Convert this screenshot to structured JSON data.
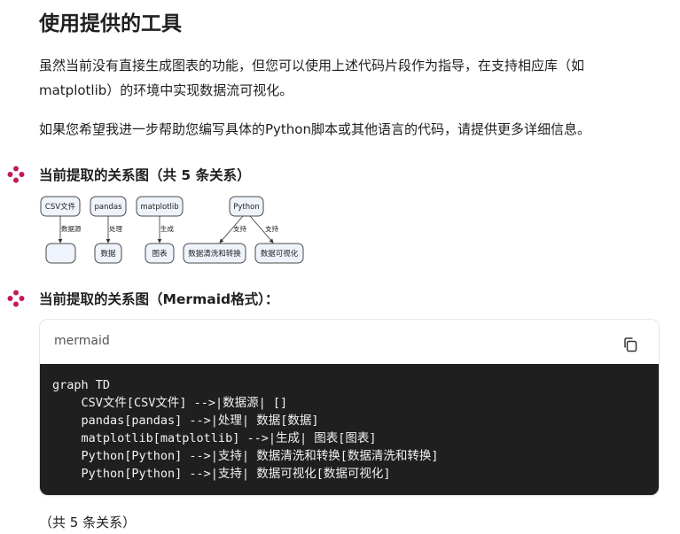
{
  "heading": "使用提供的工具",
  "paragraph1": "虽然当前没有直接生成图表的功能，但您可以使用上述代码片段作为指导，在支持相应库（如matplotlib）的环境中实现数据流可视化。",
  "paragraph2": "如果您希望我进一步帮助您编写具体的Python脚本或其他语言的代码，请提供更多详细信息。",
  "section1_title": "当前提取的关系图（共 5 条关系）",
  "section2_title": "当前提取的关系图（Mermaid格式）：",
  "diagram": {
    "nodes": {
      "csv": "CSV文件",
      "pandas": "pandas",
      "matplotlib": "matplotlib",
      "python": "Python",
      "empty": "",
      "data": "数据",
      "chart": "图表",
      "clean": "数据清洗和转换",
      "viz": "数据可视化"
    },
    "edges": {
      "csv_empty": "数据源",
      "pandas_data": "处理",
      "matplotlib_chart": "生成",
      "python_clean": "支持",
      "python_viz": "支持"
    }
  },
  "code_block": {
    "language": "mermaid",
    "copy_icon": "copy-icon",
    "lines": [
      "graph TD",
      "    CSV文件[CSV文件] -->|数据源| []",
      "    pandas[pandas] -->|处理| 数据[数据]",
      "    matplotlib[matplotlib] -->|生成| 图表[图表]",
      "    Python[Python] -->|支持| 数据清洗和转换[数据清洗和转换]",
      "    Python[Python] -->|支持| 数据可视化[数据可视化]"
    ]
  },
  "footer_text": "（共 5 条关系）",
  "colors": {
    "accent_icon": "#c2185b",
    "node_fill": "#eef3fc",
    "node_stroke": "#4a4a4a",
    "code_bg": "#1f1f1f"
  }
}
